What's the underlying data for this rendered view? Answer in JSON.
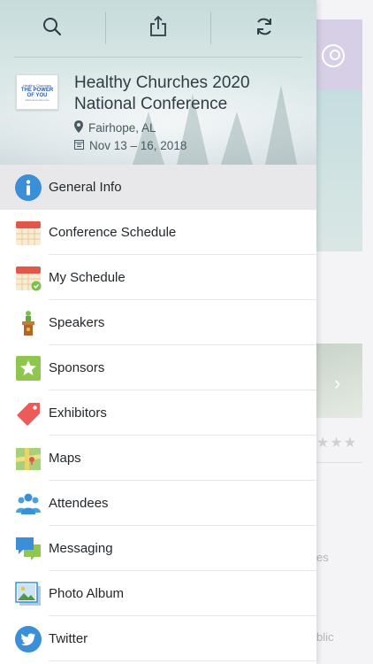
{
  "toolbar": {
    "search_icon": "search-icon",
    "share_icon": "share-icon",
    "refresh_icon": "refresh-icon"
  },
  "event": {
    "title_line1": "Healthy Churches 2020",
    "title_line2": "National Conference",
    "location": "Fairhope, AL",
    "dates": "Nov 13 – 16, 2018",
    "logo": {
      "line1": "Healthy Churches",
      "line2a": "THE POWER",
      "line2b": "OF YOU",
      "line3": "National Conference"
    }
  },
  "menu": {
    "items": [
      {
        "label": "General Info",
        "icon": "info-icon",
        "active": true
      },
      {
        "label": "Conference Schedule",
        "icon": "calendar-icon"
      },
      {
        "label": "My Schedule",
        "icon": "calendar-check-icon"
      },
      {
        "label": "Speakers",
        "icon": "podium-icon"
      },
      {
        "label": "Sponsors",
        "icon": "star-badge-icon"
      },
      {
        "label": "Exhibitors",
        "icon": "tag-icon"
      },
      {
        "label": "Maps",
        "icon": "map-icon"
      },
      {
        "label": "Attendees",
        "icon": "people-icon"
      },
      {
        "label": "Messaging",
        "icon": "chat-icon"
      },
      {
        "label": "Photo Album",
        "icon": "photo-icon"
      },
      {
        "label": "Twitter",
        "icon": "twitter-icon"
      }
    ]
  },
  "background": {
    "text1": "es",
    "text2": "blic"
  },
  "colors": {
    "accent_blue": "#3a8fd6",
    "active_row": "#e8e8ea"
  }
}
